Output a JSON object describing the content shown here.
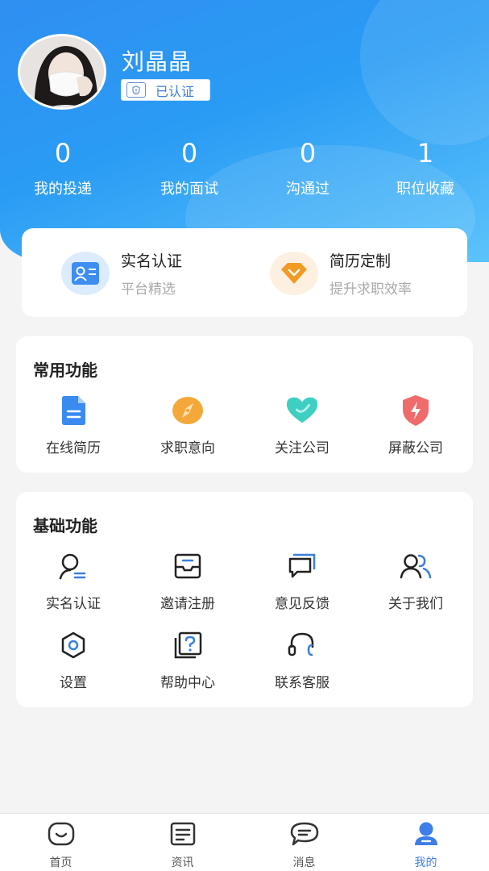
{
  "profile": {
    "name": "刘晶晶",
    "verified_label": "已认证"
  },
  "stats": [
    {
      "value": "0",
      "label": "我的投递"
    },
    {
      "value": "0",
      "label": "我的面试"
    },
    {
      "value": "0",
      "label": "沟通过"
    },
    {
      "value": "1",
      "label": "职位收藏"
    }
  ],
  "promo": [
    {
      "title": "实名认证",
      "subtitle": "平台精选",
      "icon": "id-card-icon",
      "color": "#3d8ef0"
    },
    {
      "title": "简历定制",
      "subtitle": "提升求职效率",
      "icon": "diamond-icon",
      "color": "#f39a24"
    }
  ],
  "common": {
    "title": "常用功能",
    "items": [
      {
        "label": "在线简历",
        "icon": "resume-icon",
        "color": "#3a8af0"
      },
      {
        "label": "求职意向",
        "icon": "compass-icon",
        "color": "#f5a83a"
      },
      {
        "label": "关注公司",
        "icon": "heart-icon",
        "color": "#3fcfc2"
      },
      {
        "label": "屏蔽公司",
        "icon": "shield-bolt-icon",
        "color": "#f06b6b"
      }
    ]
  },
  "basic": {
    "title": "基础功能",
    "items": [
      {
        "label": "实名认证",
        "icon": "user-verify-icon"
      },
      {
        "label": "邀请注册",
        "icon": "inbox-icon"
      },
      {
        "label": "意见反馈",
        "icon": "feedback-icon"
      },
      {
        "label": "关于我们",
        "icon": "team-icon"
      },
      {
        "label": "设置",
        "icon": "settings-icon"
      },
      {
        "label": "帮助中心",
        "icon": "help-icon"
      },
      {
        "label": "联系客服",
        "icon": "headset-icon"
      }
    ]
  },
  "tabs": [
    {
      "label": "首页",
      "icon": "home-icon",
      "active": false
    },
    {
      "label": "资讯",
      "icon": "news-icon",
      "active": false
    },
    {
      "label": "消息",
      "icon": "message-icon",
      "active": false
    },
    {
      "label": "我的",
      "icon": "profile-icon",
      "active": true
    }
  ],
  "colors": {
    "header_gradient_start": "#2f8ff2",
    "header_gradient_end": "#5cc3fb",
    "accent": "#3f7ee8",
    "outline_icon": "#222222",
    "outline_accent": "#3a7fe0"
  }
}
